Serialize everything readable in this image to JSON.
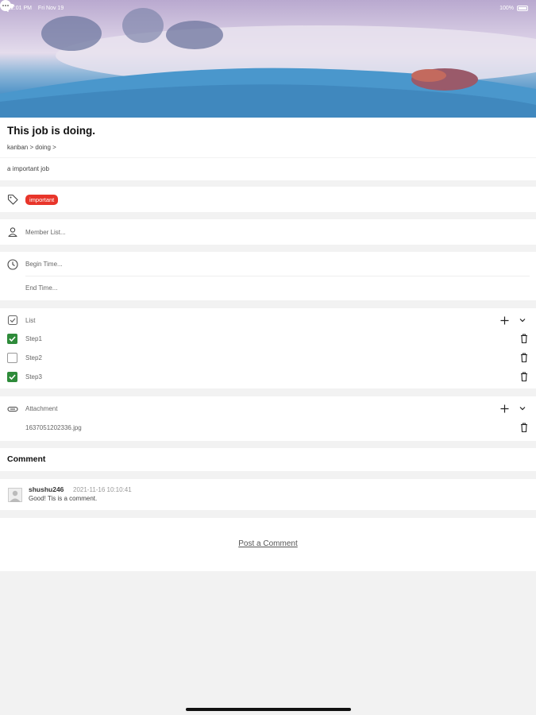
{
  "status_bar": {
    "time": "12:01 PM",
    "date": "Fri Nov 19",
    "battery": "100%"
  },
  "job": {
    "title": "This job is doing.",
    "breadcrumb": "kanban > doing >",
    "description": "a important job"
  },
  "tags": [
    {
      "label": "important",
      "color": "#e8352a"
    }
  ],
  "members": {
    "placeholder": "Member List..."
  },
  "time": {
    "begin": "Begin Time...",
    "end": "End Time..."
  },
  "checklist": {
    "label": "List",
    "items": [
      {
        "label": "Step1",
        "checked": true
      },
      {
        "label": "Step2",
        "checked": false
      },
      {
        "label": "Step3",
        "checked": true
      }
    ]
  },
  "attachments": {
    "label": "Attachment",
    "files": [
      "1637051202336.jpg"
    ]
  },
  "comments": {
    "heading": "Comment",
    "items": [
      {
        "user": "shushu246",
        "time": "2021-11-16 10:10:41",
        "text": "Good! Tis is a comment."
      }
    ],
    "post_label": "Post a Comment"
  },
  "colors": {
    "accent_green": "#2e8b3a",
    "tag_red": "#e8352a"
  }
}
